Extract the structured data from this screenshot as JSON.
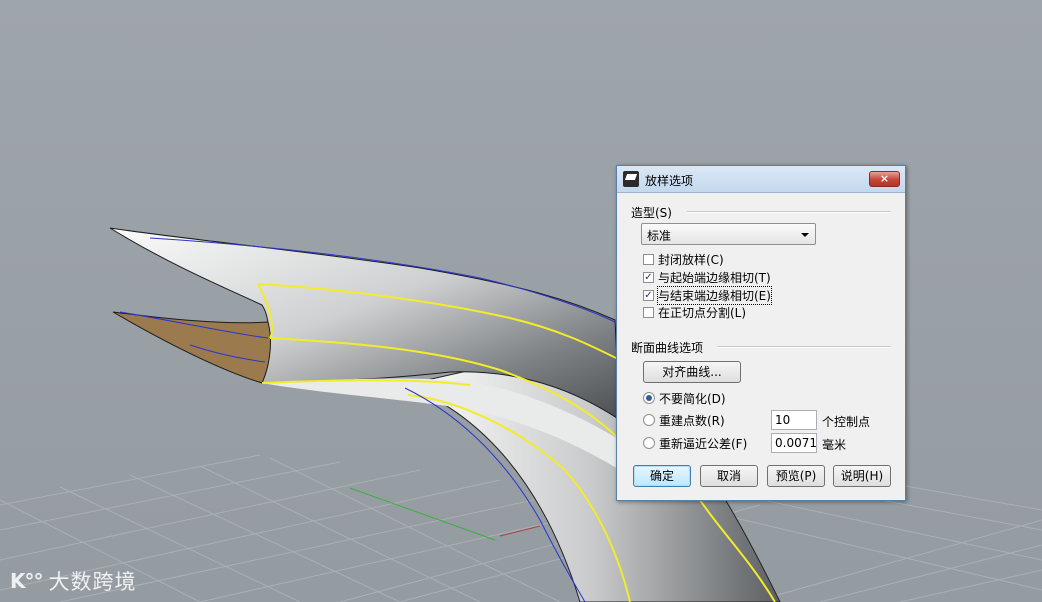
{
  "watermark": {
    "logo": "K°°",
    "text": "大数跨境"
  },
  "dialog": {
    "title": "放样选项",
    "close_label": "×",
    "style_group": {
      "label": "造型(S)",
      "selected": "标准"
    },
    "checkboxes": [
      {
        "label": "封闭放样(C)",
        "checked": false
      },
      {
        "label": "与起始端边缘相切(T)",
        "checked": true
      },
      {
        "label": "与结束端边缘相切(E)",
        "checked": true
      },
      {
        "label": "在正切点分割(L)",
        "checked": false
      }
    ],
    "section_group": {
      "label": "断面曲线选项",
      "align_button": "对齐曲线...",
      "radios": [
        {
          "label": "不要简化(D)",
          "selected": true
        },
        {
          "label": "重建点数(R)",
          "selected": false,
          "value": "10",
          "unit": "个控制点"
        },
        {
          "label": "重新逼近公差(F)",
          "selected": false,
          "value": "0.00712",
          "unit": "毫米"
        }
      ]
    },
    "buttons": {
      "ok": "确定",
      "cancel": "取消",
      "preview": "预览(P)",
      "help": "说明(H)"
    }
  },
  "colors": {
    "viewport_bg": "#9ea5ab",
    "edge_highlight": "#f2ec2a",
    "isocurve": "#2a36c9",
    "inner_surface": "#9b7a4e"
  }
}
